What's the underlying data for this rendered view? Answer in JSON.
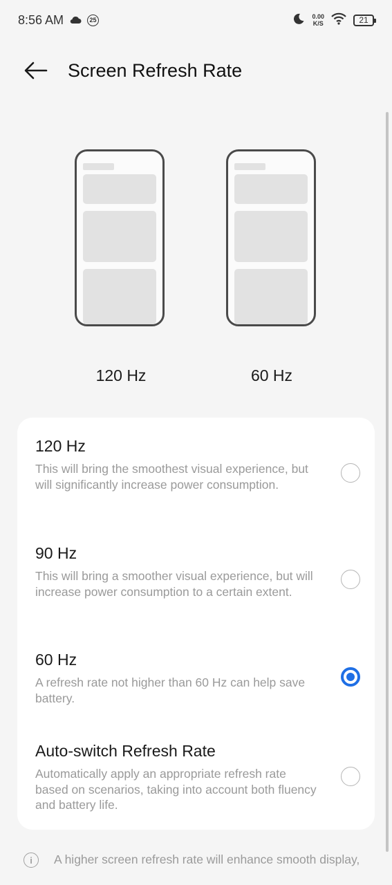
{
  "status_bar": {
    "time": "8:56 AM",
    "badge_number": "25",
    "net_speed_value": "0.00",
    "net_speed_unit": "K/S",
    "battery_level": "21"
  },
  "header": {
    "title": "Screen Refresh Rate"
  },
  "preview": {
    "left_label": "120 Hz",
    "right_label": "60 Hz"
  },
  "options": [
    {
      "title": "120 Hz",
      "description": "This will bring the smoothest visual experience, but will significantly increase power consumption.",
      "selected": false
    },
    {
      "title": "90 Hz",
      "description": "This will bring a smoother visual experience, but will increase power consumption to a certain extent.",
      "selected": false
    },
    {
      "title": "60 Hz",
      "description": "A refresh rate not higher than 60 Hz can help save battery.",
      "selected": true
    },
    {
      "title": "Auto-switch Refresh Rate",
      "description": "Automatically apply an appropriate refresh rate based on scenarios, taking into account both fluency and battery life.",
      "selected": false
    }
  ],
  "footer": {
    "note": "A higher screen refresh rate will enhance smooth display, but will reduce the battery life."
  },
  "colors": {
    "accent": "#1f6fe5",
    "background": "#f5f5f5",
    "card": "#ffffff"
  }
}
